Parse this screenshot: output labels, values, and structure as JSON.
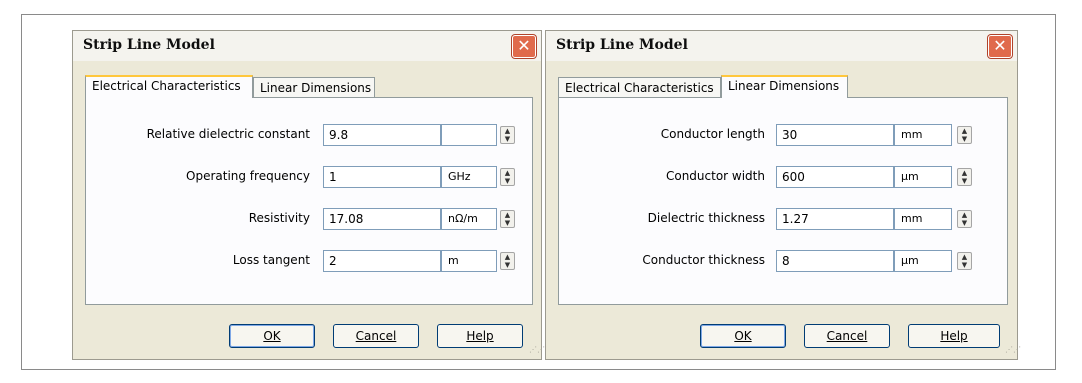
{
  "dialogs": [
    {
      "title": "Strip Line Model",
      "tabs": [
        "Electrical Characteristics",
        "Linear Dimensions"
      ],
      "active_tab": 0,
      "fields": [
        {
          "label": "Relative dielectric constant",
          "value": "9.8",
          "unit": ""
        },
        {
          "label": "Operating frequency",
          "value": "1",
          "unit": "GHz"
        },
        {
          "label": "Resistivity",
          "value": "17.08",
          "unit": "nΩ/m"
        },
        {
          "label": "Loss tangent",
          "value": "2",
          "unit": "m"
        }
      ],
      "buttons": {
        "ok": "OK",
        "cancel": "Cancel",
        "help": "Help"
      }
    },
    {
      "title": "Strip Line Model",
      "tabs": [
        "Electrical Characteristics",
        "Linear Dimensions"
      ],
      "active_tab": 1,
      "fields": [
        {
          "label": "Conductor length",
          "value": "30",
          "unit": "mm"
        },
        {
          "label": "Conductor width",
          "value": "600",
          "unit": "µm"
        },
        {
          "label": "Dielectric thickness",
          "value": "1.27",
          "unit": "mm"
        },
        {
          "label": "Conductor thickness",
          "value": "8",
          "unit": "µm"
        }
      ],
      "buttons": {
        "ok": "OK",
        "cancel": "Cancel",
        "help": "Help"
      }
    }
  ],
  "icons": {
    "close": "close-icon",
    "spinner": "spinner-icon",
    "resize_grip": "resize-grip-icon"
  }
}
